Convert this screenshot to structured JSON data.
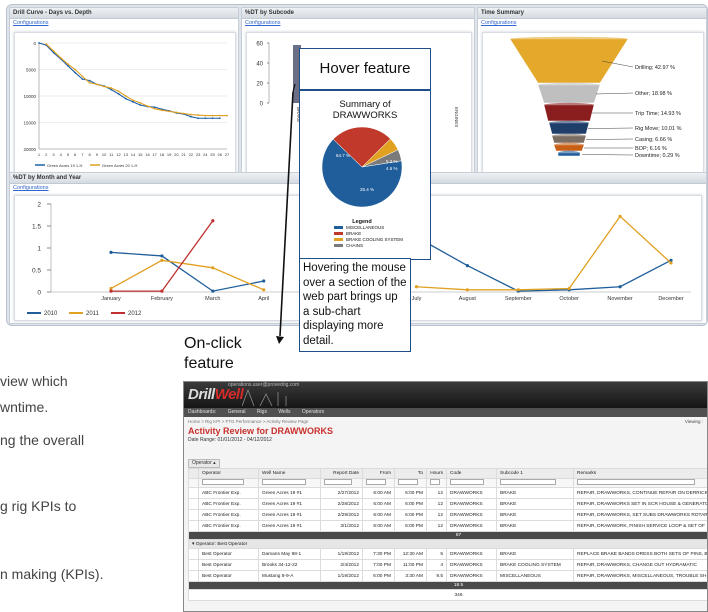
{
  "dashboard": {
    "panels": {
      "drill_curve": {
        "title": "Drill Curve - Days vs. Depth",
        "link": "Configurations",
        "legend": [
          "Green Acres 19 1-H",
          "Green Acres 20 1-H"
        ]
      },
      "pdt_subcode": {
        "title": "%DT by Subcode",
        "link": "Configurations"
      },
      "time_summary": {
        "title": "Time Summary",
        "link": "Configurations"
      },
      "month_year": {
        "title": "%DT by Month and Year",
        "link": "Configurations"
      }
    }
  },
  "chart_data": [
    {
      "type": "line",
      "title": "Drill Curve - Days vs. Depth",
      "x": [
        1,
        2,
        3,
        4,
        5,
        6,
        7,
        8,
        9,
        10,
        11,
        12,
        13,
        14,
        15,
        16,
        17,
        18,
        19,
        20,
        21,
        22,
        23,
        24,
        25,
        26,
        27
      ],
      "ylim": [
        20000,
        0
      ],
      "y_ticks": [
        "0",
        "5000",
        "10000",
        "15000",
        "20000"
      ],
      "series": [
        {
          "name": "Green Acres 19 1-H",
          "color": "#1a5fa8",
          "values": [
            0,
            400,
            1800,
            3000,
            4300,
            5600,
            6800,
            7100,
            7800,
            8100,
            8800,
            9600,
            10500,
            11100,
            11700,
            12000,
            12100,
            12500,
            12800,
            13200,
            13400,
            13900,
            14200,
            14200,
            14200,
            14200,
            null
          ]
        },
        {
          "name": "Green Acres 20 1-H",
          "color": "#e0a020",
          "values": [
            null,
            200,
            1500,
            2800,
            4000,
            5000,
            6300,
            7500,
            7800,
            8200,
            8500,
            9100,
            10000,
            10800,
            11300,
            11900,
            12400,
            12700,
            12900,
            13100,
            13300,
            13500,
            13600,
            13700,
            13700,
            13700,
            13700
          ]
        }
      ]
    },
    {
      "type": "bar",
      "title": "%DT by Subcode",
      "ylim": [
        0,
        60
      ],
      "y_ticks": [
        "0",
        "20",
        "40",
        "60"
      ],
      "categories": [
        "",
        "ENGINES"
      ],
      "values": [
        58,
        0
      ],
      "bar_labels": [
        "BRAKE",
        "ENGINES"
      ]
    },
    {
      "type": "bar",
      "title": "Time Summary",
      "categories": [
        "Drilling",
        "Other",
        "Trip Time",
        "Rig Move",
        "Casing",
        "BOP",
        "Downtime"
      ],
      "values": [
        42.97,
        18.98,
        14.93,
        10.01,
        6.66,
        6.16,
        0.29
      ],
      "labels": [
        "Drilling; 42.97 %",
        "Other; 18.98 %",
        "Trip Time; 14.93 %",
        "Rig Move; 10.01 %",
        "Casing; 6.66 %",
        "BOP; 6.16 %",
        "Downtime; 0.29 %"
      ],
      "colors": [
        "#e4a92a",
        "#bfbfbf",
        "#8a1d1d",
        "#1f3e6a",
        "#7c6d63",
        "#c85f16",
        "#1f5e9a"
      ]
    },
    {
      "type": "line",
      "title": "%DT by Month and Year",
      "categories": [
        "January",
        "February",
        "March",
        "April",
        "May",
        "June",
        "July",
        "August",
        "September",
        "October",
        "November",
        "December"
      ],
      "ylim": [
        0,
        2
      ],
      "y_ticks": [
        "0",
        "0.5",
        "1",
        "1.5",
        "2"
      ],
      "series": [
        {
          "name": "2010",
          "color": "#1f5e9a",
          "values": [
            0.9,
            0.82,
            0.02,
            0.25,
            null,
            null,
            1.25,
            0.6,
            0.02,
            0.05,
            0.12,
            0.72
          ]
        },
        {
          "name": "2011",
          "color": "#e0a020",
          "values": [
            0.08,
            0.72,
            0.55,
            0.05,
            null,
            null,
            0.12,
            0.05,
            0.05,
            0.08,
            1.72,
            0.66
          ]
        },
        {
          "name": "2012",
          "color": "#c03030",
          "values": [
            0.02,
            0.02,
            1.62,
            null,
            null,
            null,
            null,
            null,
            null,
            null,
            null,
            null
          ]
        }
      ]
    },
    {
      "type": "pie",
      "title": "Summary of DRAWWORKS",
      "categories": [
        "MISCELLANEOUS",
        "BRAKE",
        "BRAKE COOLING SYSTEM",
        "CHAINS"
      ],
      "values": [
        64.7,
        25.4,
        5.3,
        4.6
      ],
      "labels": [
        "64.7 %",
        "25.4 %",
        "5.3 %",
        "4.6 %"
      ],
      "colors": [
        "#1f5e9a",
        "#c0392b",
        "#e0a020",
        "#7a7a7a"
      ]
    }
  ],
  "callouts": {
    "hover_title": "Hover feature",
    "subchart_title_line1": "Summary of",
    "subchart_title_line2": "DRAWWORKS",
    "legend_title": "Legend",
    "hover_desc": "Hovering the mouse over a section of the web part brings up a sub-chart displaying more detail.",
    "onclick_line1": "On-click",
    "onclick_line2": "feature"
  },
  "background_text": [
    "view which",
    "wntime.",
    "ng the overall",
    "g rig KPIs to",
    "n making (KPIs)."
  ],
  "report": {
    "logo_a": "Drill",
    "logo_b": "Well",
    "email": "operations.user@provedrig.com",
    "nav": [
      "Dashboards:",
      "General",
      "Rigs",
      "Wells",
      "Operators"
    ],
    "crumbs": "Home > Rig KPI > FTG Performance > Activity Review Page",
    "viewing": "Viewing :",
    "title": "Activity Review for DRAWWORKS",
    "date_range": "Date Range: 01/01/2012 - 04/12/2012",
    "group_by": "Operator",
    "columns": [
      "Operator",
      "Well Name",
      "Report Date",
      "From",
      "To",
      "Hours",
      "Code",
      "Subcode 1",
      "Remarks"
    ],
    "rows": [
      [
        "ABC Frontier Exp.",
        "Green Acres 19 #1",
        "2/27/2012",
        "6:00 AM",
        "6:00 PM",
        "12",
        "DRAWWORKS",
        "BRAKE",
        "REPAIR, DRAWWORKS, CONTINUE REPAIR ON DERRICK"
      ],
      [
        "ABC Frontier Exp.",
        "Green Acres 19 #1",
        "2/28/2012",
        "6:00 AM",
        "6:00 PM",
        "12",
        "DRAWWORKS",
        "BRAKE",
        "REPAIR, DRAWWORKS SET IN SCR HOUSE & GENERATOR"
      ],
      [
        "ABC Frontier Exp.",
        "Green Acres 19 #1",
        "2/29/2012",
        "6:00 AM",
        "6:00 PM",
        "12",
        "DRAWWORKS",
        "BRAKE",
        "REPAIR, DRAWWORKS, SET SUBS DRAWWORKS ROTARY"
      ],
      [
        "ABC Frontier Exp.",
        "Green Acres 19 #1",
        "3/1/2012",
        "6:00 AM",
        "6:00 PM",
        "12",
        "DRAWWORKS",
        "BRAKE",
        "REPAIR, DRAWWORK, FINISH SERVICE LOOP & SET OF"
      ]
    ],
    "subtotal_1": "87",
    "group_2": "Operator: Best Operator",
    "rows_2": [
      [
        "Best Operator",
        "Damans May 98-1",
        "1/19/2012",
        "7:30 PM",
        "12:30 AM",
        "5",
        "DRAWWORKS",
        "BRAKE",
        "REPLACE BRAKE BANDS DRESS BOTH SETS OF PINS, B"
      ],
      [
        "Best Operator",
        "Brooks 34-12-22",
        "2/4/2012",
        "7:00 PM",
        "11:00 PM",
        "4",
        "DRAWWORKS",
        "BRAKE COOLING SYSTEM",
        "REPAIR, DRAWWORKS, CHANGE OUT HYDRAMATIC"
      ],
      [
        "Best Operator",
        "Mustang 8-9-A",
        "1/19/2012",
        "6:00 PM",
        "3:30 AM",
        "9.5",
        "DRAWWORKS",
        "MISCELLANEOUS",
        "REPAIR, DRAWWORKS, MISCELLANEOUS, TROUBLE SH"
      ]
    ],
    "subtotal_2": "18.5",
    "grand_total": "346"
  }
}
